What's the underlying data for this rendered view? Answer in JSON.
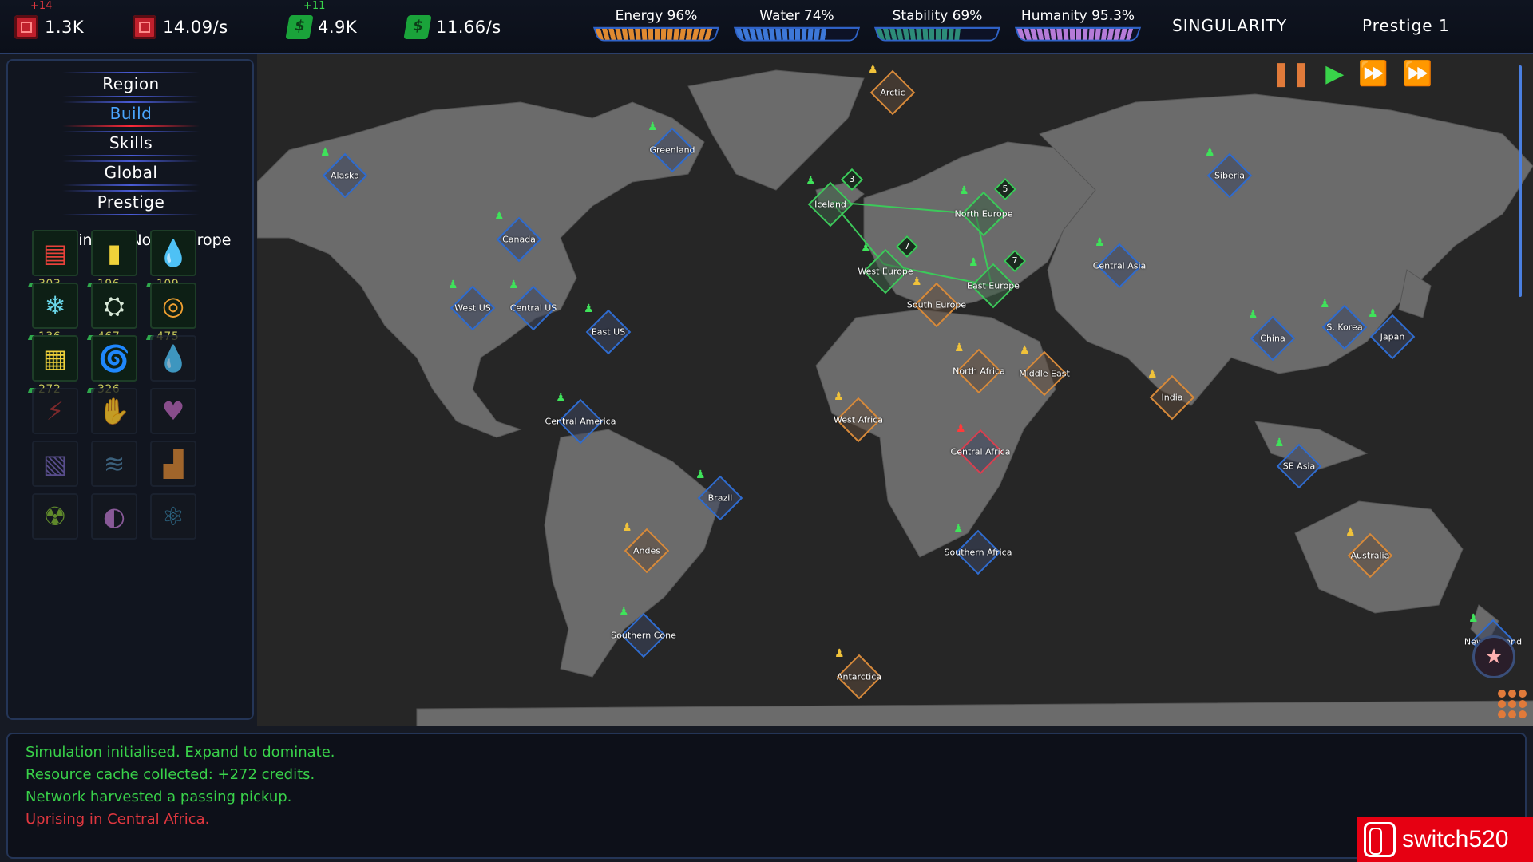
{
  "topbar": {
    "resources": [
      {
        "name": "compute",
        "icon": "chip-icon",
        "value": "1.3K",
        "delta": "+14",
        "delta_color": "#e0373f"
      },
      {
        "name": "compute-rate",
        "icon": "chip-icon",
        "value": "14.09/s"
      },
      {
        "name": "credits",
        "icon": "cash-icon",
        "value": "4.9K",
        "delta": "+11",
        "delta_color": "#39d24a"
      },
      {
        "name": "credits-rate",
        "icon": "cash-icon",
        "value": "11.66/s"
      }
    ],
    "meters": [
      {
        "label": "Energy 96%",
        "level": 0.96
      },
      {
        "label": "Water 74%",
        "level": 0.74
      },
      {
        "label": "Stability 69%",
        "level": 0.69
      },
      {
        "label": "Humanity 95.3%",
        "level": 0.953
      }
    ],
    "singularity": "SINGULARITY",
    "prestige": "Prestige 1"
  },
  "sidebar": {
    "tabs": [
      "Region",
      "Build",
      "Skills",
      "Global",
      "Prestige"
    ],
    "active_tab": "Build",
    "building_in": "Building in: North Europe",
    "buildings": [
      {
        "icon": "server-icon",
        "glyph": "▤",
        "color": "#e8413a",
        "cost": "303",
        "enabled": true
      },
      {
        "icon": "battery-icon",
        "glyph": "▮",
        "color": "#f0d23a",
        "cost": "196",
        "enabled": true
      },
      {
        "icon": "water-drop-icon",
        "glyph": "💧",
        "color": "#2fc6e0",
        "cost": "109",
        "enabled": true
      },
      {
        "icon": "cooling-icon",
        "glyph": "❄",
        "color": "#6ad6e8",
        "cost": "136",
        "enabled": true
      },
      {
        "icon": "robot-icon",
        "glyph": "⛭",
        "color": "#d8e8d8",
        "cost": "467",
        "enabled": true
      },
      {
        "icon": "vault-icon",
        "glyph": "◎",
        "color": "#f0a030",
        "cost": "475",
        "enabled": true
      },
      {
        "icon": "solar-panel-icon",
        "glyph": "▦",
        "color": "#f0d23a",
        "cost": "272",
        "enabled": true
      },
      {
        "icon": "wind-icon",
        "glyph": "🌀",
        "color": "#3ab8e8",
        "cost": "326",
        "enabled": true
      },
      {
        "icon": "dark-drop-icon",
        "glyph": "💧",
        "color": "#3a5a8a",
        "cost": "",
        "enabled": false
      },
      {
        "icon": "antenna-icon",
        "glyph": "⚡",
        "color": "#a03030",
        "cost": "",
        "enabled": false
      },
      {
        "icon": "hand-seed-icon",
        "glyph": "✋",
        "color": "#d0a040",
        "cost": "",
        "enabled": false
      },
      {
        "icon": "heart-hands-icon",
        "glyph": "♥",
        "color": "#b060b0",
        "cost": "",
        "enabled": false
      },
      {
        "icon": "chip-card-icon",
        "glyph": "▧",
        "color": "#7060b0",
        "cost": "",
        "enabled": false
      },
      {
        "icon": "waves-icon",
        "glyph": "≋",
        "color": "#4a7a9a",
        "cost": "",
        "enabled": false
      },
      {
        "icon": "factory-icon",
        "glyph": "▟",
        "color": "#d08030",
        "cost": "",
        "enabled": false
      },
      {
        "icon": "nuclear-icon",
        "glyph": "☢",
        "color": "#7ab030",
        "cost": "",
        "enabled": false
      },
      {
        "icon": "brain-icon",
        "glyph": "◐",
        "color": "#b070c0",
        "cost": "",
        "enabled": false
      },
      {
        "icon": "atom-icon",
        "glyph": "⚛",
        "color": "#3a8ab0",
        "cost": "",
        "enabled": false
      }
    ]
  },
  "map": {
    "controls": {
      "pause": "❚❚",
      "play": "▶",
      "fast": "⏩",
      "faster": "⏩"
    },
    "regions": [
      {
        "name": "Arctic",
        "status": "orange"
      },
      {
        "name": "Alaska",
        "status": "blue"
      },
      {
        "name": "Greenland",
        "status": "blue"
      },
      {
        "name": "Iceland",
        "status": "green",
        "badge": "3"
      },
      {
        "name": "North Europe",
        "status": "green",
        "badge": "5"
      },
      {
        "name": "Siberia",
        "status": "blue"
      },
      {
        "name": "Canada",
        "status": "blue"
      },
      {
        "name": "West Europe",
        "status": "green",
        "badge": "7"
      },
      {
        "name": "East Europe",
        "status": "green",
        "badge": "7"
      },
      {
        "name": "Central Asia",
        "status": "blue"
      },
      {
        "name": "West US",
        "status": "blue"
      },
      {
        "name": "Central US",
        "status": "blue"
      },
      {
        "name": "East US",
        "status": "blue"
      },
      {
        "name": "South Europe",
        "status": "orange"
      },
      {
        "name": "China",
        "status": "blue"
      },
      {
        "name": "S. Korea",
        "status": "blue"
      },
      {
        "name": "Japan",
        "status": "blue"
      },
      {
        "name": "North Africa",
        "status": "orange"
      },
      {
        "name": "Middle East",
        "status": "orange"
      },
      {
        "name": "India",
        "status": "orange"
      },
      {
        "name": "West Africa",
        "status": "orange"
      },
      {
        "name": "Central America",
        "status": "blue"
      },
      {
        "name": "Central Africa",
        "status": "red"
      },
      {
        "name": "SE Asia",
        "status": "blue"
      },
      {
        "name": "Brazil",
        "status": "blue"
      },
      {
        "name": "Andes",
        "status": "orange"
      },
      {
        "name": "Southern Africa",
        "status": "blue"
      },
      {
        "name": "Australia",
        "status": "orange"
      },
      {
        "name": "Southern Cone",
        "status": "blue"
      },
      {
        "name": "Antarctica",
        "status": "orange"
      },
      {
        "name": "New Zealand",
        "status": "blue"
      }
    ]
  },
  "log": {
    "lines": [
      {
        "text": "Simulation initialised. Expand to dominate.",
        "type": "ok"
      },
      {
        "text": "Resource cache collected: +272 credits.",
        "type": "ok"
      },
      {
        "text": "Network harvested a passing pickup.",
        "type": "ok"
      },
      {
        "text": "Uprising in Central Africa.",
        "type": "bad"
      }
    ]
  },
  "watermark": {
    "text": "switch520"
  }
}
